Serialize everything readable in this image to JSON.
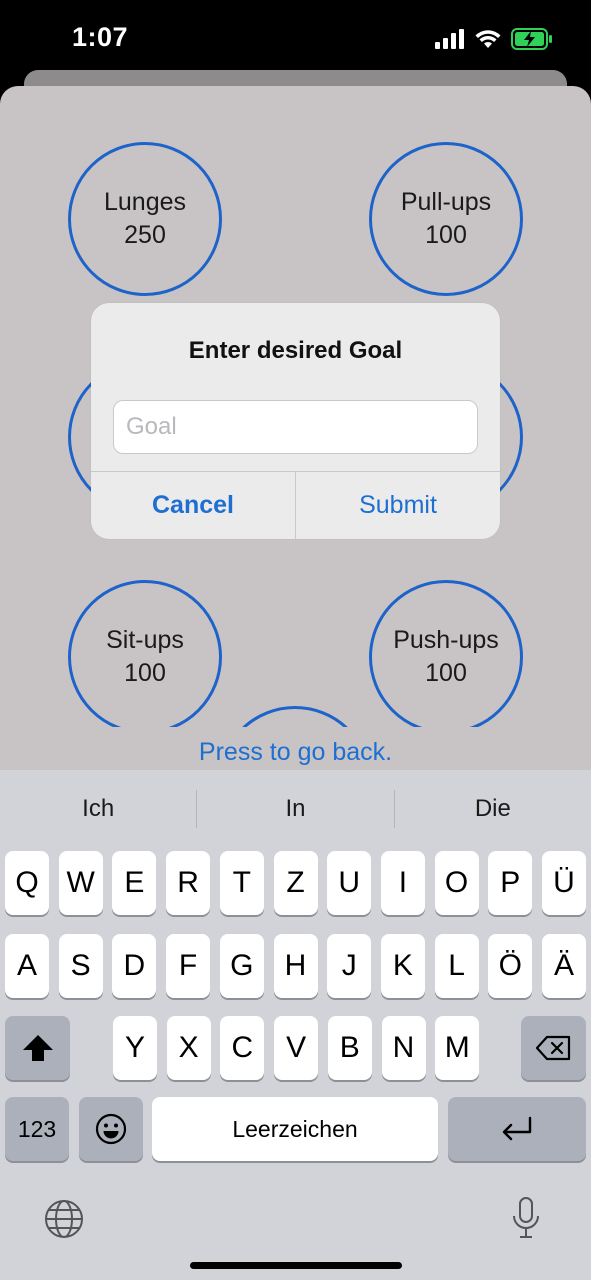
{
  "status_bar": {
    "time": "1:07"
  },
  "exercises": [
    {
      "name": "Lunges",
      "goal": "250"
    },
    {
      "name": "Pull-ups",
      "goal": "100"
    },
    {
      "name": "Sit-ups",
      "goal": "100"
    },
    {
      "name": "Push-ups",
      "goal": "100"
    }
  ],
  "back_link": "Press to go back.",
  "alert": {
    "title": "Enter desired Goal",
    "input_placeholder": "Goal",
    "input_value": "",
    "cancel_label": "Cancel",
    "submit_label": "Submit"
  },
  "keyboard": {
    "suggestions": [
      "Ich",
      "In",
      "Die"
    ],
    "row1": [
      "Q",
      "W",
      "E",
      "R",
      "T",
      "Z",
      "U",
      "I",
      "O",
      "P",
      "Ü"
    ],
    "row2": [
      "A",
      "S",
      "D",
      "F",
      "G",
      "H",
      "J",
      "K",
      "L",
      "Ö",
      "Ä"
    ],
    "row3": [
      "Y",
      "X",
      "C",
      "V",
      "B",
      "N",
      "M"
    ],
    "numbers_label": "123",
    "space_label": "Leerzeichen"
  },
  "colors": {
    "accent": "#1d6fd1",
    "circle_border": "#1d63c9",
    "sheet_bg": "#c8c4c5",
    "keyboard_bg": "#d1d3d9"
  }
}
